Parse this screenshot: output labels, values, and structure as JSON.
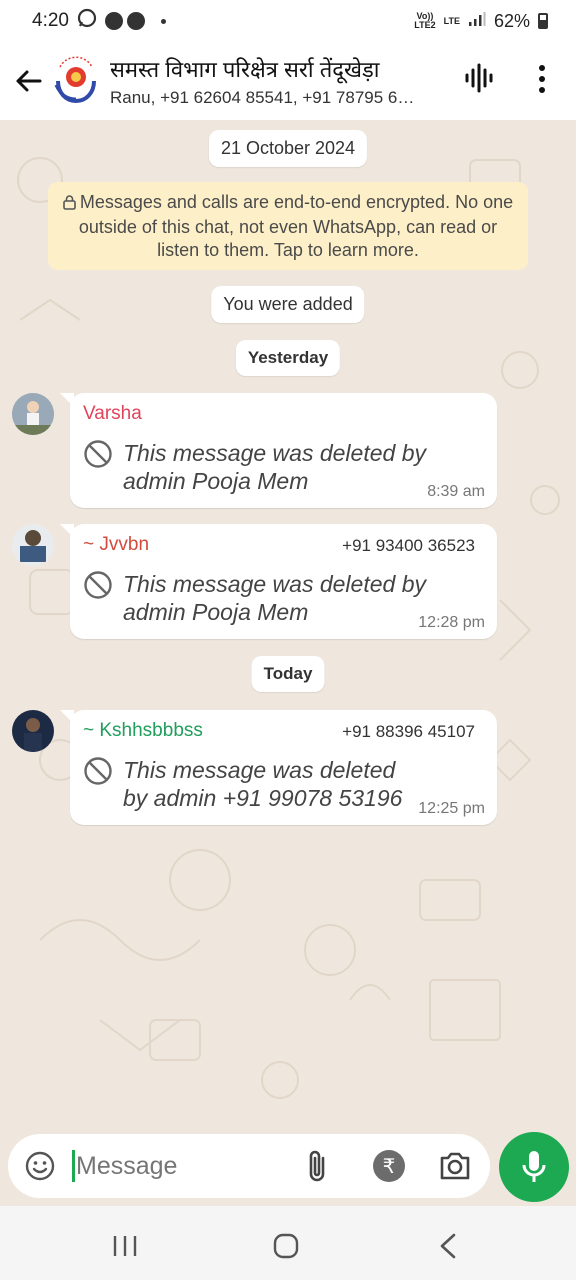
{
  "status_bar": {
    "time": "4:20",
    "network_top": "Vo))",
    "network_bottom": "LTE2",
    "lte": "LTE",
    "battery": "62%"
  },
  "header": {
    "title": "समस्त विभाग परिक्षेत्र सर्रा तेंदूखेड़ा",
    "subtitle": "Ranu, +91 62604 85541, +91 78795 6…"
  },
  "chat": {
    "date_chip": "21 October 2024",
    "encryption_notice": "Messages and calls are end-to-end encrypted. No one outside of this chat, not even WhatsApp, can read or listen to them. Tap to learn more.",
    "system_message": "You were added",
    "day_yesterday": "Yesterday",
    "day_today": "Today",
    "messages": [
      {
        "sender": "Varsha",
        "phone": "",
        "text": "This message was deleted by admin Pooja Mem",
        "time": "8:39 am",
        "color": "#e0445a"
      },
      {
        "sender": "~ Jvvbn",
        "phone": "+91 93400 36523",
        "text": "This message was deleted by admin Pooja Mem",
        "time": "12:28 pm",
        "color": "#d14b3e"
      },
      {
        "sender": "~ Kshhsbbbss",
        "phone": "+91 88396 45107",
        "text": "This message was deleted by admin +91 99078 53196",
        "time": "12:25 pm",
        "color": "#1f9e5c"
      }
    ]
  },
  "composer": {
    "placeholder": "Message"
  },
  "colors": {
    "accent_green": "#1da952",
    "chat_bg": "#efe7dd",
    "notice_bg": "#fdf0c9"
  },
  "icons": [
    "back-arrow-icon",
    "group-logo",
    "voice-chat-icon",
    "more-options-icon",
    "blocked-icon",
    "emoji-icon",
    "attach-icon",
    "rupee-icon",
    "camera-icon",
    "mic-icon",
    "recents-icon",
    "home-icon",
    "back-icon"
  ]
}
